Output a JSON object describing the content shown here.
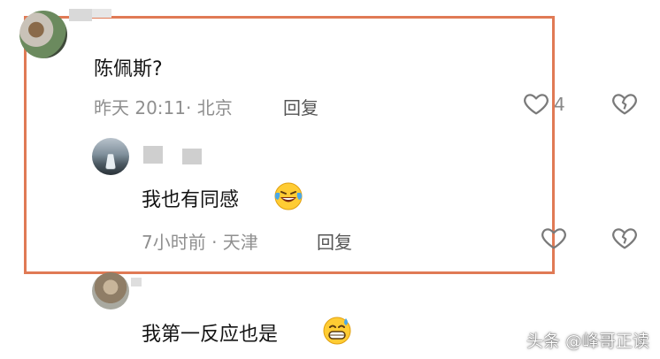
{
  "comments": [
    {
      "text": "陈佩斯?",
      "meta": "昨天 20:11· 北京",
      "reply_label": "回复",
      "like_count": "4"
    },
    {
      "text": "我也有同感",
      "meta": "7小时前 · 天津",
      "reply_label": "回复"
    },
    {
      "text": "我第一反应也是"
    }
  ],
  "watermark": "头条 @峰哥正读",
  "colors": {
    "highlight_border": "#e07a55",
    "meta_text": "#8f8f8f",
    "icon_gray": "#777777"
  },
  "icons": [
    "heart-outline-icon",
    "broken-heart-icon",
    "laughing-tears-emoji",
    "grinning-sweat-emoji"
  ]
}
